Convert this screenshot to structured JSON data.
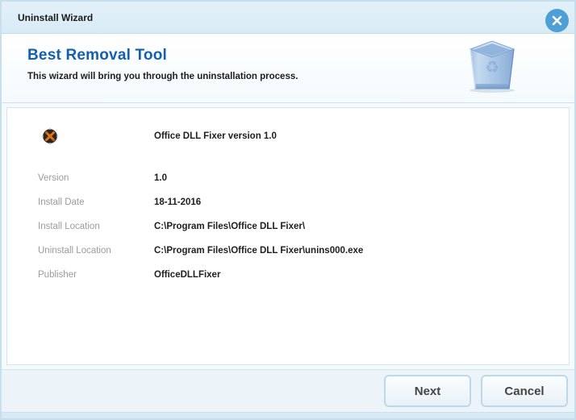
{
  "window": {
    "title": "Uninstall Wizard"
  },
  "header": {
    "title": "Best Removal Tool",
    "subtitle": "This wizard will bring you through the uninstallation process.",
    "accent_color": "#1460af",
    "icons": {
      "close_icon": "circled-x",
      "trash_icon": "blue-translucent-recycle-bin"
    }
  },
  "details": {
    "app_icon": "dark-circle-with-orange-crossed-tools",
    "app_title": "Office DLL Fixer version 1.0",
    "rows": [
      {
        "label": "Version",
        "value": "1.0"
      },
      {
        "label": "Install Date",
        "value": "18-11-2016"
      },
      {
        "label": "Install Location",
        "value": "C:\\Program Files\\Office DLL Fixer\\"
      },
      {
        "label": "Uninstall Location",
        "value": "C:\\Program Files\\Office DLL Fixer\\unins000.exe"
      },
      {
        "label": "Publisher",
        "value": "OfficeDLLFixer"
      }
    ]
  },
  "footer": {
    "next_label": "Next",
    "cancel_label": "Cancel"
  },
  "colors": {
    "titlebar_bg": "#dcedf7",
    "close_button": "#4d9fd6",
    "footer_bg": "#ecf4fa",
    "panel_border": "#d5e4ef",
    "window_border": "#c6deee",
    "label_gray": "#9b9b9b"
  }
}
